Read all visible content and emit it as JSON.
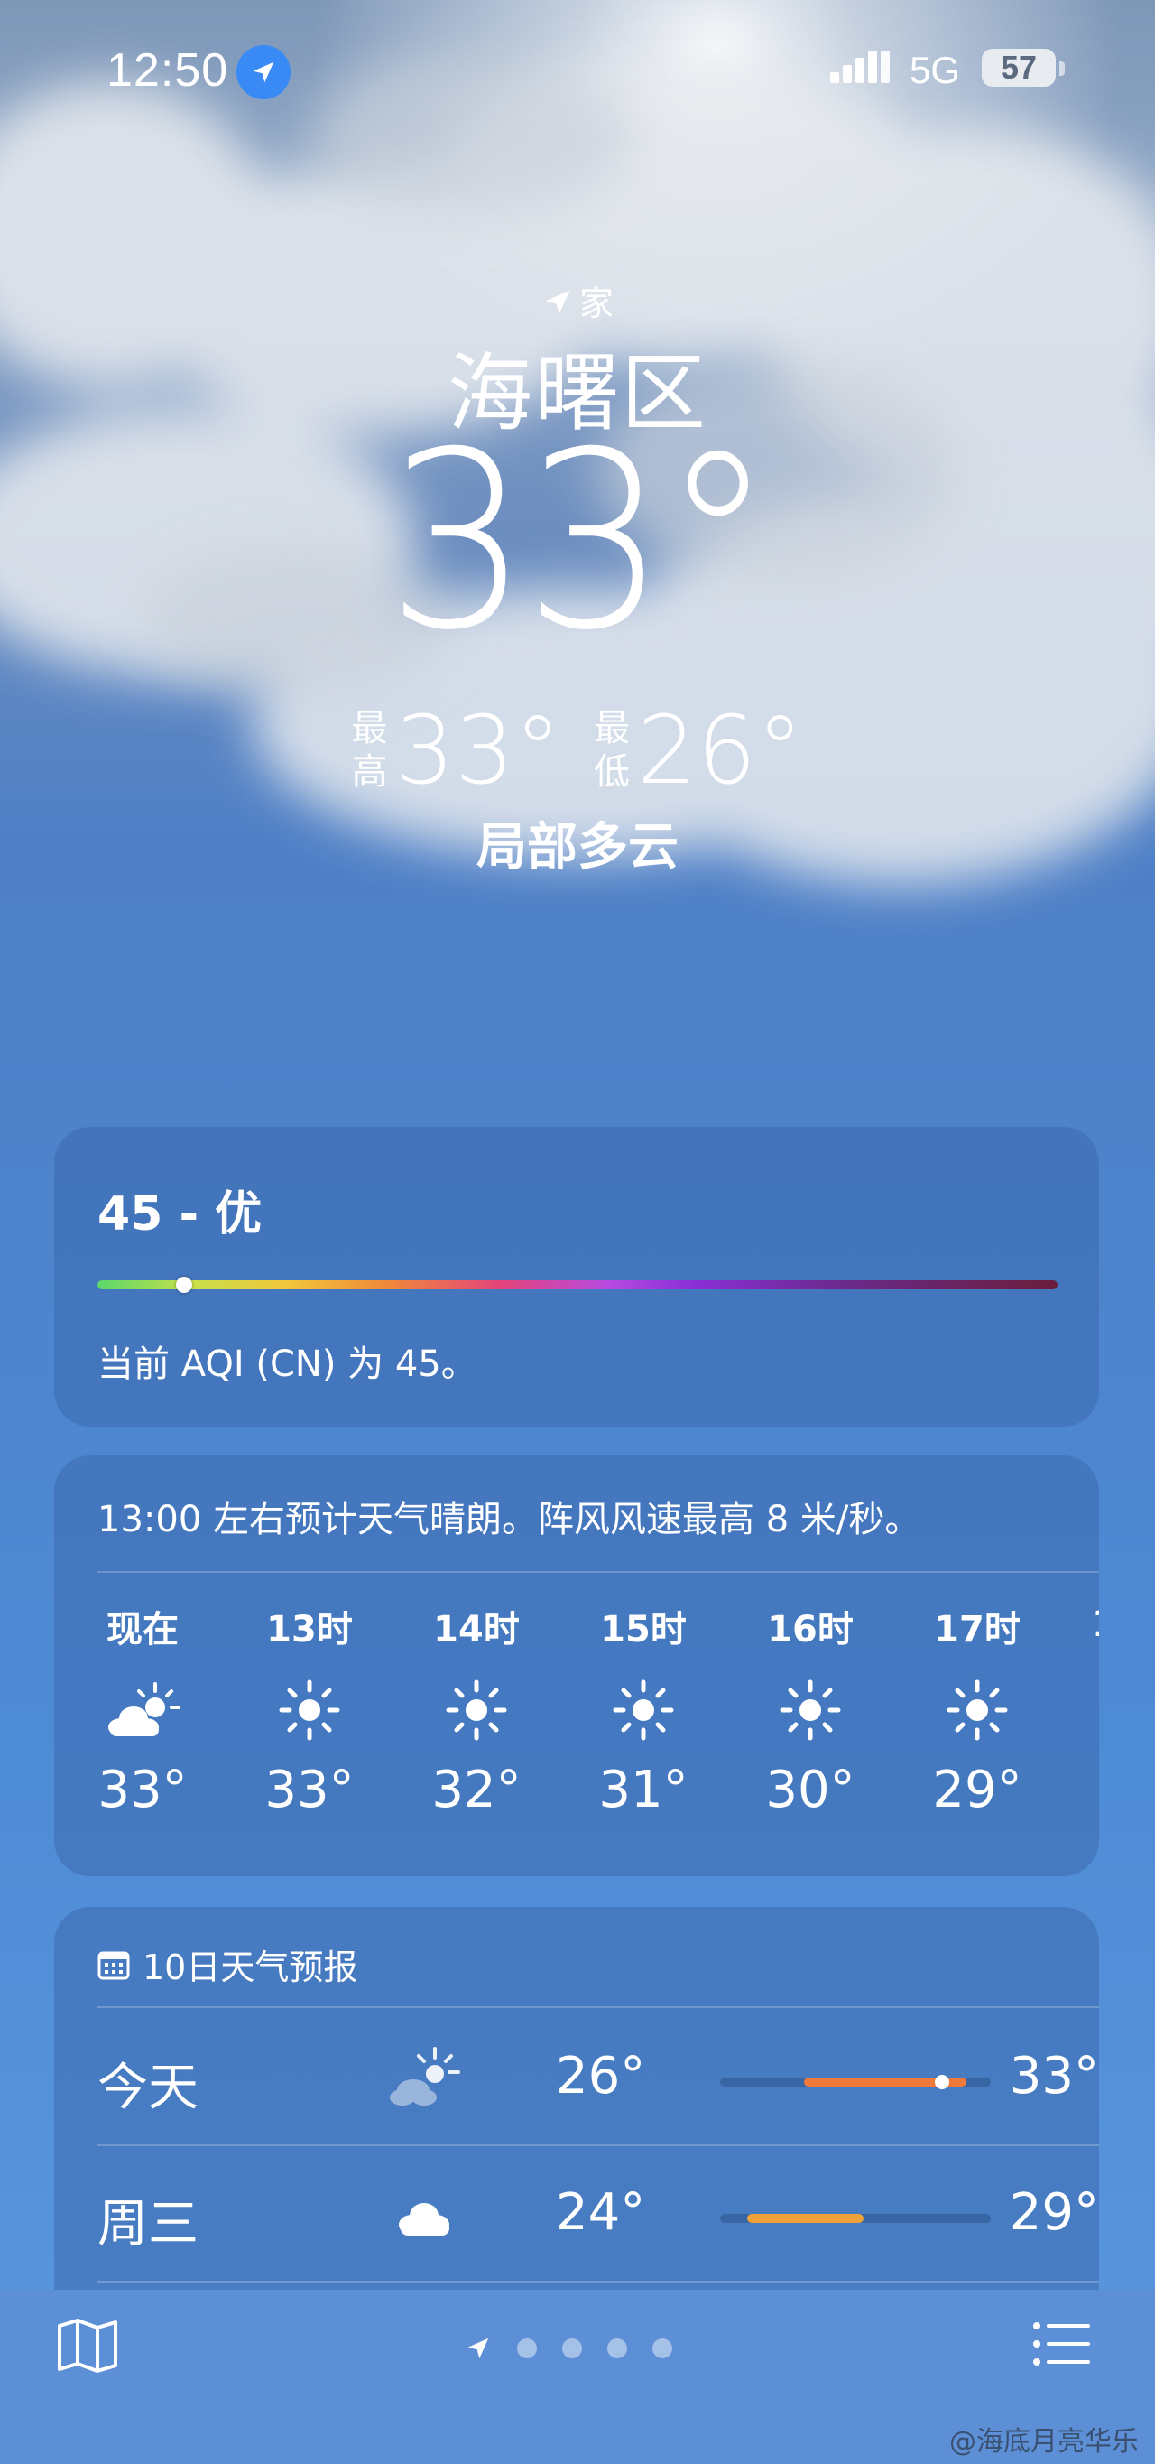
{
  "status_bar": {
    "time": "12:50",
    "network": "5G",
    "battery": "57"
  },
  "header": {
    "location_tag": "家",
    "city": "海曙区",
    "temperature": "33°",
    "high_label": "最高",
    "high": "33°",
    "low_label": "最低",
    "low": "26°",
    "condition": "局部多云"
  },
  "aqi": {
    "value_label": "45 - 优",
    "description": "当前 AQI (CN) 为 45。",
    "level_fraction": 0.09
  },
  "hourly": {
    "summary": "13:00 左右预计天气晴朗。阵风风速最高 8 米/秒。",
    "hours": [
      {
        "label": "现在",
        "icon": "partly-cloudy-icon",
        "temp": "33°"
      },
      {
        "label": "13时",
        "icon": "sun-icon",
        "temp": "33°"
      },
      {
        "label": "14时",
        "icon": "sun-icon",
        "temp": "32°"
      },
      {
        "label": "15时",
        "icon": "sun-icon",
        "temp": "31°"
      },
      {
        "label": "16时",
        "icon": "sun-icon",
        "temp": "30°"
      },
      {
        "label": "17时",
        "icon": "sun-icon",
        "temp": "29°"
      }
    ],
    "next_partial": "1"
  },
  "daily": {
    "title": "10日天气预报",
    "days": [
      {
        "name": "今天",
        "icon": "partly-sunny-icon",
        "low": "26°",
        "high": "33°",
        "range_start": 0.31,
        "range_end": 0.91,
        "current": 0.82,
        "bar_color": "#f07a3c"
      },
      {
        "name": "周三",
        "icon": "cloud-icon",
        "low": "24°",
        "high": "29°",
        "range_start": 0.1,
        "range_end": 0.53,
        "bar_color": "#f0a23a"
      }
    ]
  },
  "bottom": {
    "page_count": 4,
    "active": "location"
  },
  "watermark": "@海底月亮华乐"
}
